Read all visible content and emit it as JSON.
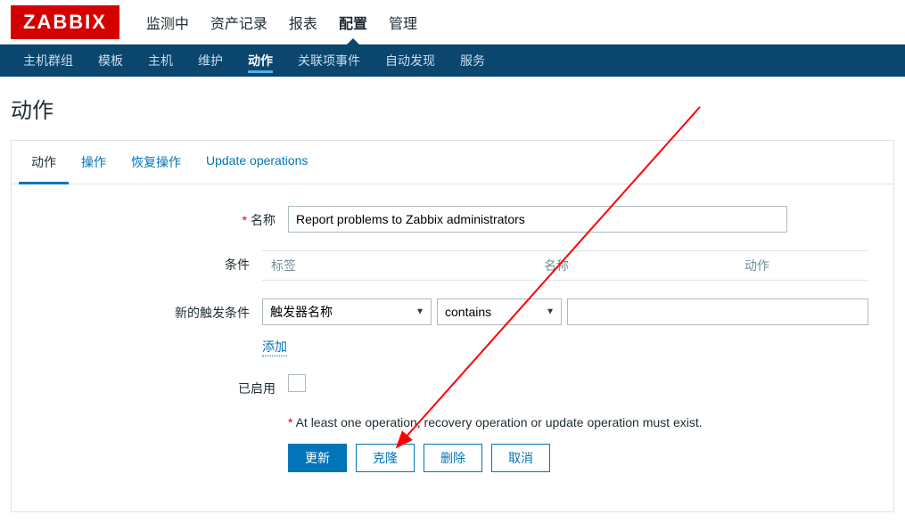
{
  "brand": "ZABBIX",
  "topNav": {
    "items": [
      "监测中",
      "资产记录",
      "报表",
      "配置",
      "管理"
    ],
    "activeIndex": 3
  },
  "subNav": {
    "items": [
      "主机群组",
      "模板",
      "主机",
      "维护",
      "动作",
      "关联项事件",
      "自动发现",
      "服务"
    ],
    "activeIndex": 4
  },
  "pageTitle": "动作",
  "tabs": {
    "items": [
      "动作",
      "操作",
      "恢复操作",
      "Update operations"
    ],
    "activeIndex": 0
  },
  "form": {
    "nameLabel": "名称",
    "nameValue": "Report problems to Zabbix administrators",
    "conditionsLabel": "条件",
    "conditionsHeader": {
      "c1": "标签",
      "c2": "名称",
      "c3": "动作"
    },
    "newTriggerLabel": "新的触发条件",
    "triggerSelect1": "触发器名称",
    "triggerSelect2": "contains",
    "triggerText": "",
    "addLink": "添加",
    "enabledLabel": "已启用",
    "hintStar": "*",
    "hintText": " At least one operation, recovery operation or update operation must exist.",
    "buttons": {
      "update": "更新",
      "clone": "克隆",
      "delete": "删除",
      "cancel": "取消"
    }
  }
}
